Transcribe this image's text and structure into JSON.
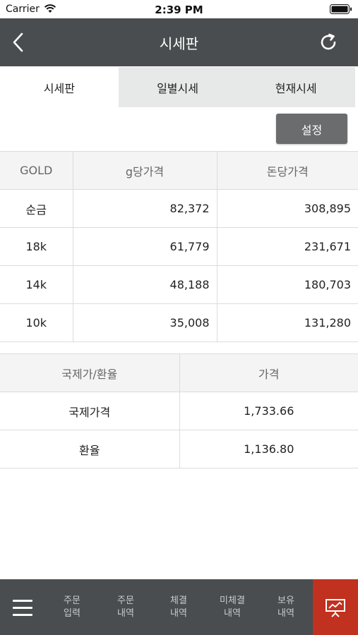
{
  "status_bar": {
    "carrier": "Carrier",
    "time": "2:39 PM"
  },
  "header": {
    "title": "시세판",
    "back_icon": "chevron-left-icon",
    "refresh_icon": "refresh-icon"
  },
  "tabs": [
    {
      "label": "시세판",
      "active": true
    },
    {
      "label": "일별시세",
      "active": false
    },
    {
      "label": "현재시세",
      "active": false
    }
  ],
  "setting_button": {
    "label": "설정"
  },
  "gold_table": {
    "headers": [
      "GOLD",
      "g당가격",
      "돈당가격"
    ],
    "rows": [
      {
        "name": "순금",
        "per_gram": "82,372",
        "per_don": "308,895"
      },
      {
        "name": "18k",
        "per_gram": "61,779",
        "per_don": "231,671"
      },
      {
        "name": "14k",
        "per_gram": "48,188",
        "per_don": "180,703"
      },
      {
        "name": "10k",
        "per_gram": "35,008",
        "per_don": "131,280"
      }
    ]
  },
  "intl_table": {
    "headers": [
      "국제가/환율",
      "가격"
    ],
    "rows": [
      {
        "name": "국제가격",
        "price": "1,733.66"
      },
      {
        "name": "환율",
        "price": "1,136.80"
      }
    ]
  },
  "bottom_nav": {
    "menu_icon": "hamburger-menu-icon",
    "items": [
      {
        "line1": "주문",
        "line2": "입력"
      },
      {
        "line1": "주문",
        "line2": "내역"
      },
      {
        "line1": "체결",
        "line2": "내역"
      },
      {
        "line1": "미체결",
        "line2": "내역"
      },
      {
        "line1": "보유",
        "line2": "내역"
      }
    ],
    "board_icon": "presentation-board-icon",
    "accent_color": "#c1311f",
    "bar_color": "#4a4d4f"
  }
}
